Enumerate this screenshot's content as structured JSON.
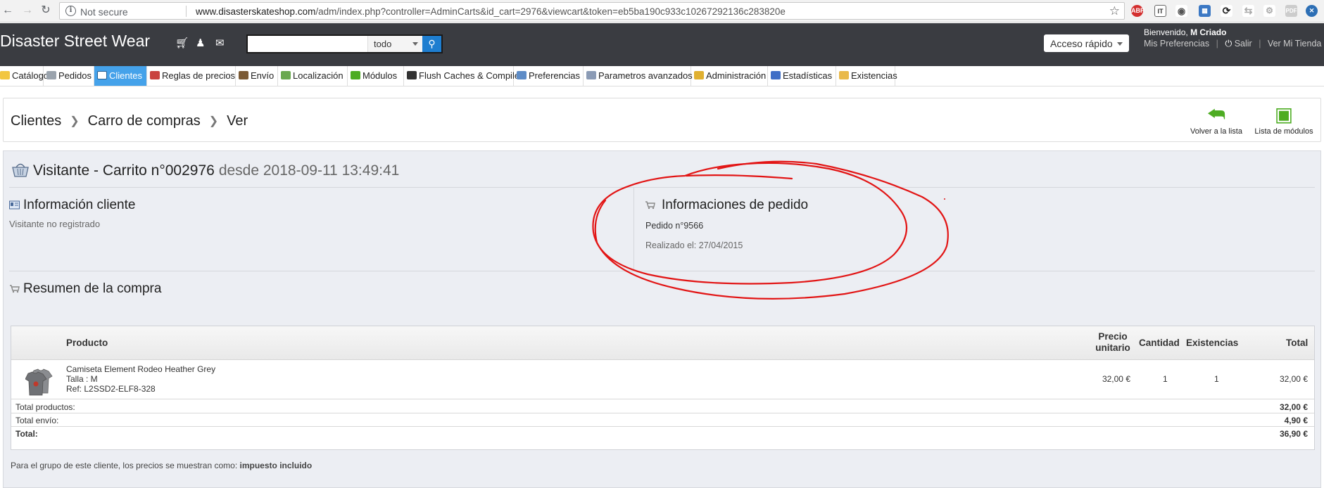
{
  "browser": {
    "security_label": "Not secure",
    "url_host": "www.disasterskateshop.com",
    "url_path": "/adm/index.php?controller=AdminCarts&id_cart=2976&viewcart&token=eb5ba190c933c10267292136c283820e",
    "extensions": [
      "ABP",
      "IT",
      "eye",
      "calendar",
      "sync",
      "reload",
      "puzzle",
      "pdf",
      "chrome"
    ]
  },
  "header": {
    "brand": "Disaster Street Wear",
    "search_scope": "todo",
    "search_value": "",
    "quick_access": "Acceso rápido",
    "welcome_prefix": "Bienvenido,",
    "welcome_user": "M Criado",
    "links": {
      "preferences": "Mis Preferencias",
      "logout": "Salir",
      "store": "Ver Mi Tienda"
    }
  },
  "tabs": [
    {
      "label": "Catálogo",
      "color": "#f2c641"
    },
    {
      "label": "Pedidos",
      "color": "#9aa3ad"
    },
    {
      "label": "Clientes",
      "color": "#ffffff",
      "active": true
    },
    {
      "label": "Reglas de precios",
      "color": "#c9423f"
    },
    {
      "label": "Envío",
      "color": "#7b5a35"
    },
    {
      "label": "Localización",
      "color": "#6aa84f"
    },
    {
      "label": "Módulos",
      "color": "#4dac22"
    },
    {
      "label": "Flush Caches & Compile",
      "color": "#333333"
    },
    {
      "label": "Preferencias",
      "color": "#5d8cc7"
    },
    {
      "label": "Parametros avanzados",
      "color": "#8b9bb5"
    },
    {
      "label": "Administración",
      "color": "#e0b030"
    },
    {
      "label": "Estadísticas",
      "color": "#3f6ec6"
    },
    {
      "label": "Existencias",
      "color": "#e9b949"
    }
  ],
  "breadcrumb": [
    "Clientes",
    "Carro de compras",
    "Ver"
  ],
  "toolbar": {
    "back_label": "Volver a la lista",
    "modules_label": "Lista de módulos"
  },
  "cart": {
    "title": "Visitante - Carrito n°002976",
    "since": "desde 2018-09-11 13:49:41"
  },
  "customer_info": {
    "title": "Información cliente",
    "text": "Visitante no registrado"
  },
  "order_info": {
    "title": "Informaciones de pedido",
    "order": "Pedido n°9566",
    "placed": "Realizado el: 27/04/2015"
  },
  "summary": {
    "title": "Resumen de la compra",
    "columns": {
      "product": "Producto",
      "unit_price_1": "Precio",
      "unit_price_2": "unitario",
      "quantity": "Cantidad",
      "stock": "Existencias",
      "total": "Total"
    },
    "product": {
      "name": "Camiseta Element Rodeo Heather Grey",
      "size": "Talla : M",
      "ref": "Ref: L2SSD2-ELF8-328",
      "unit_price": "32,00 €",
      "quantity": "1",
      "stock": "1",
      "total": "32,00 €"
    },
    "totals": [
      {
        "label": "Total productos:",
        "value": "32,00 €"
      },
      {
        "label": "Total envío:",
        "value": "4,90 €"
      },
      {
        "label": "Total:",
        "value": "36,90 €",
        "bold": true
      }
    ],
    "footnote_prefix": "Para el grupo de este cliente, los precios se muestran como:",
    "footnote_value": "impuesto incluido"
  }
}
